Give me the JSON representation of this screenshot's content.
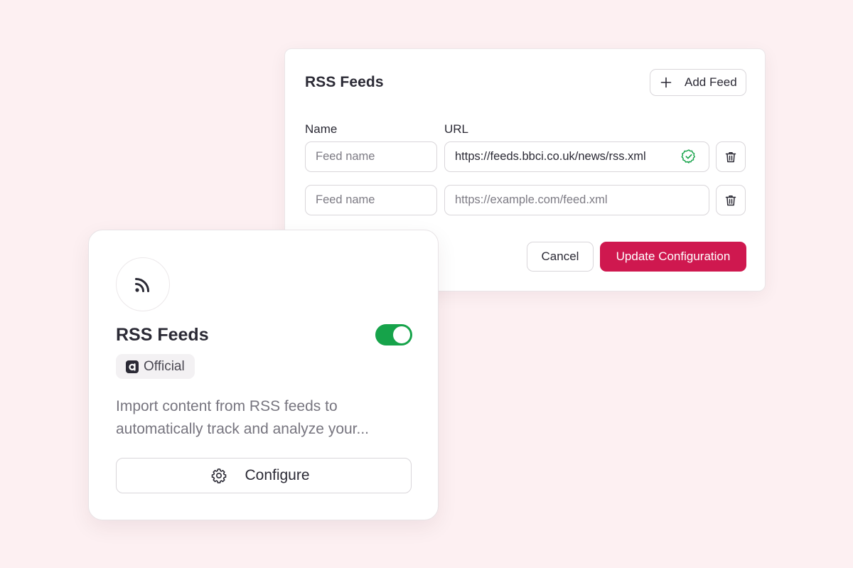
{
  "config_panel": {
    "title": "RSS Feeds",
    "add_feed_label": "Add Feed",
    "columns": {
      "name": "Name",
      "url": "URL"
    },
    "feeds": [
      {
        "name_value": "",
        "name_placeholder": "Feed name",
        "url_value": "https://feeds.bbci.co.uk/news/rss.xml",
        "url_placeholder": "",
        "validated": true
      },
      {
        "name_value": "",
        "name_placeholder": "Feed name",
        "url_value": "",
        "url_placeholder": "https://example.com/feed.xml",
        "validated": false
      }
    ],
    "cancel_label": "Cancel",
    "update_label": "Update Configuration",
    "colors": {
      "primary": "#cf184f",
      "valid": "#16a34a"
    }
  },
  "card": {
    "icon": "rss-icon",
    "title": "RSS Feeds",
    "enabled": true,
    "badge_label": "Official",
    "badge_icon": "brand-logo-icon",
    "description": "Import content from RSS feeds to automatically track and analyze your...",
    "configure_label": "Configure",
    "configure_icon": "gear-icon",
    "colors": {
      "toggle_on": "#16a34a"
    }
  },
  "colors": {
    "background": "#fdf0f2"
  }
}
